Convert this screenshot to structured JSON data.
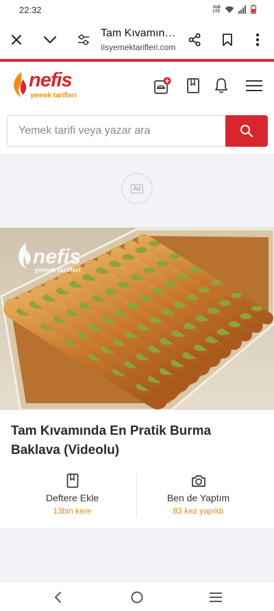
{
  "status_bar": {
    "time": "22:32",
    "net_top": "VoB",
    "net_bottom": "LTE",
    "icons": [
      "wifi-icon",
      "signal-icon",
      "battery-icon"
    ]
  },
  "browser": {
    "title": "Tam Kıvamın…",
    "url": "ïisyemektarifleri.com",
    "icons": [
      "close-icon",
      "chevron-down-icon",
      "page-settings-icon",
      "share-icon",
      "bookmark-icon",
      "more-vertical-icon"
    ]
  },
  "site": {
    "logo_word": "nefis",
    "logo_sub": "yemek tarifleri",
    "header_icons": [
      "add-recipe-icon",
      "notebook-icon",
      "bell-icon",
      "menu-icon"
    ],
    "accent": "#d9262e",
    "secondary": "#f28c14"
  },
  "search": {
    "placeholder": "Yemek tarifi veya yazar ara",
    "value": ""
  },
  "ad": {
    "label": "Ad"
  },
  "hero": {
    "watermark_word": "nefis",
    "watermark_sub": "yemek tarifleri"
  },
  "recipe": {
    "title": "Tam Kıvamında En Pratik Burma Baklava (Videolu)"
  },
  "actions": [
    {
      "label": "Deftere Ekle",
      "count": "13bin kere",
      "icon": "notebook-icon"
    },
    {
      "label": "Ben de Yaptım",
      "count": "83 kez yapıldı",
      "icon": "camera-icon"
    }
  ],
  "nav": {
    "icons": [
      "back-icon",
      "home-icon",
      "recent-apps-icon"
    ]
  }
}
